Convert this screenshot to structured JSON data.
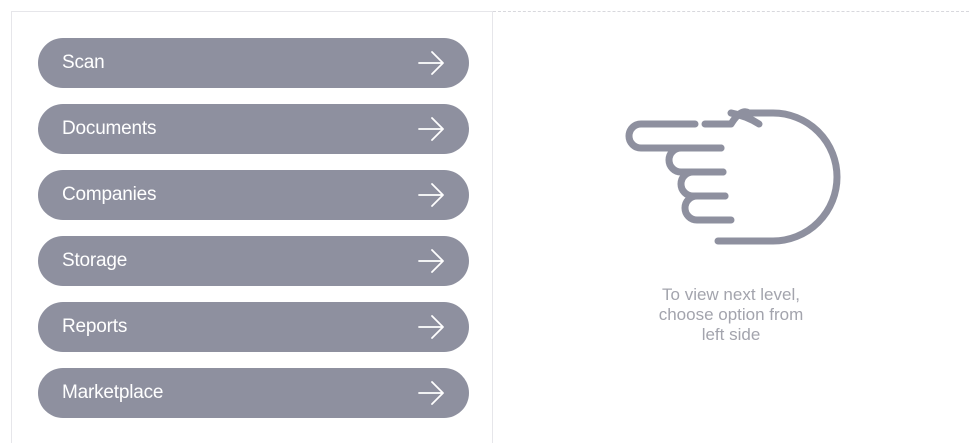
{
  "menu": {
    "items": [
      {
        "label": "Scan",
        "icon": "arrow-right-icon"
      },
      {
        "label": "Documents",
        "icon": "arrow-right-icon"
      },
      {
        "label": "Companies",
        "icon": "arrow-right-icon"
      },
      {
        "label": "Storage",
        "icon": "arrow-right-icon"
      },
      {
        "label": "Reports",
        "icon": "arrow-right-icon"
      },
      {
        "label": "Marketplace",
        "icon": "arrow-right-icon"
      }
    ]
  },
  "hint": {
    "icon": "pointing-hand-icon",
    "lines": [
      "To view next level,",
      "choose option from",
      "left side"
    ]
  },
  "colors": {
    "menu_item_background": "#8e909f",
    "menu_item_text": "#ffffff",
    "hint_icon": "#8e909f",
    "hint_text": "#a3a4ad"
  }
}
